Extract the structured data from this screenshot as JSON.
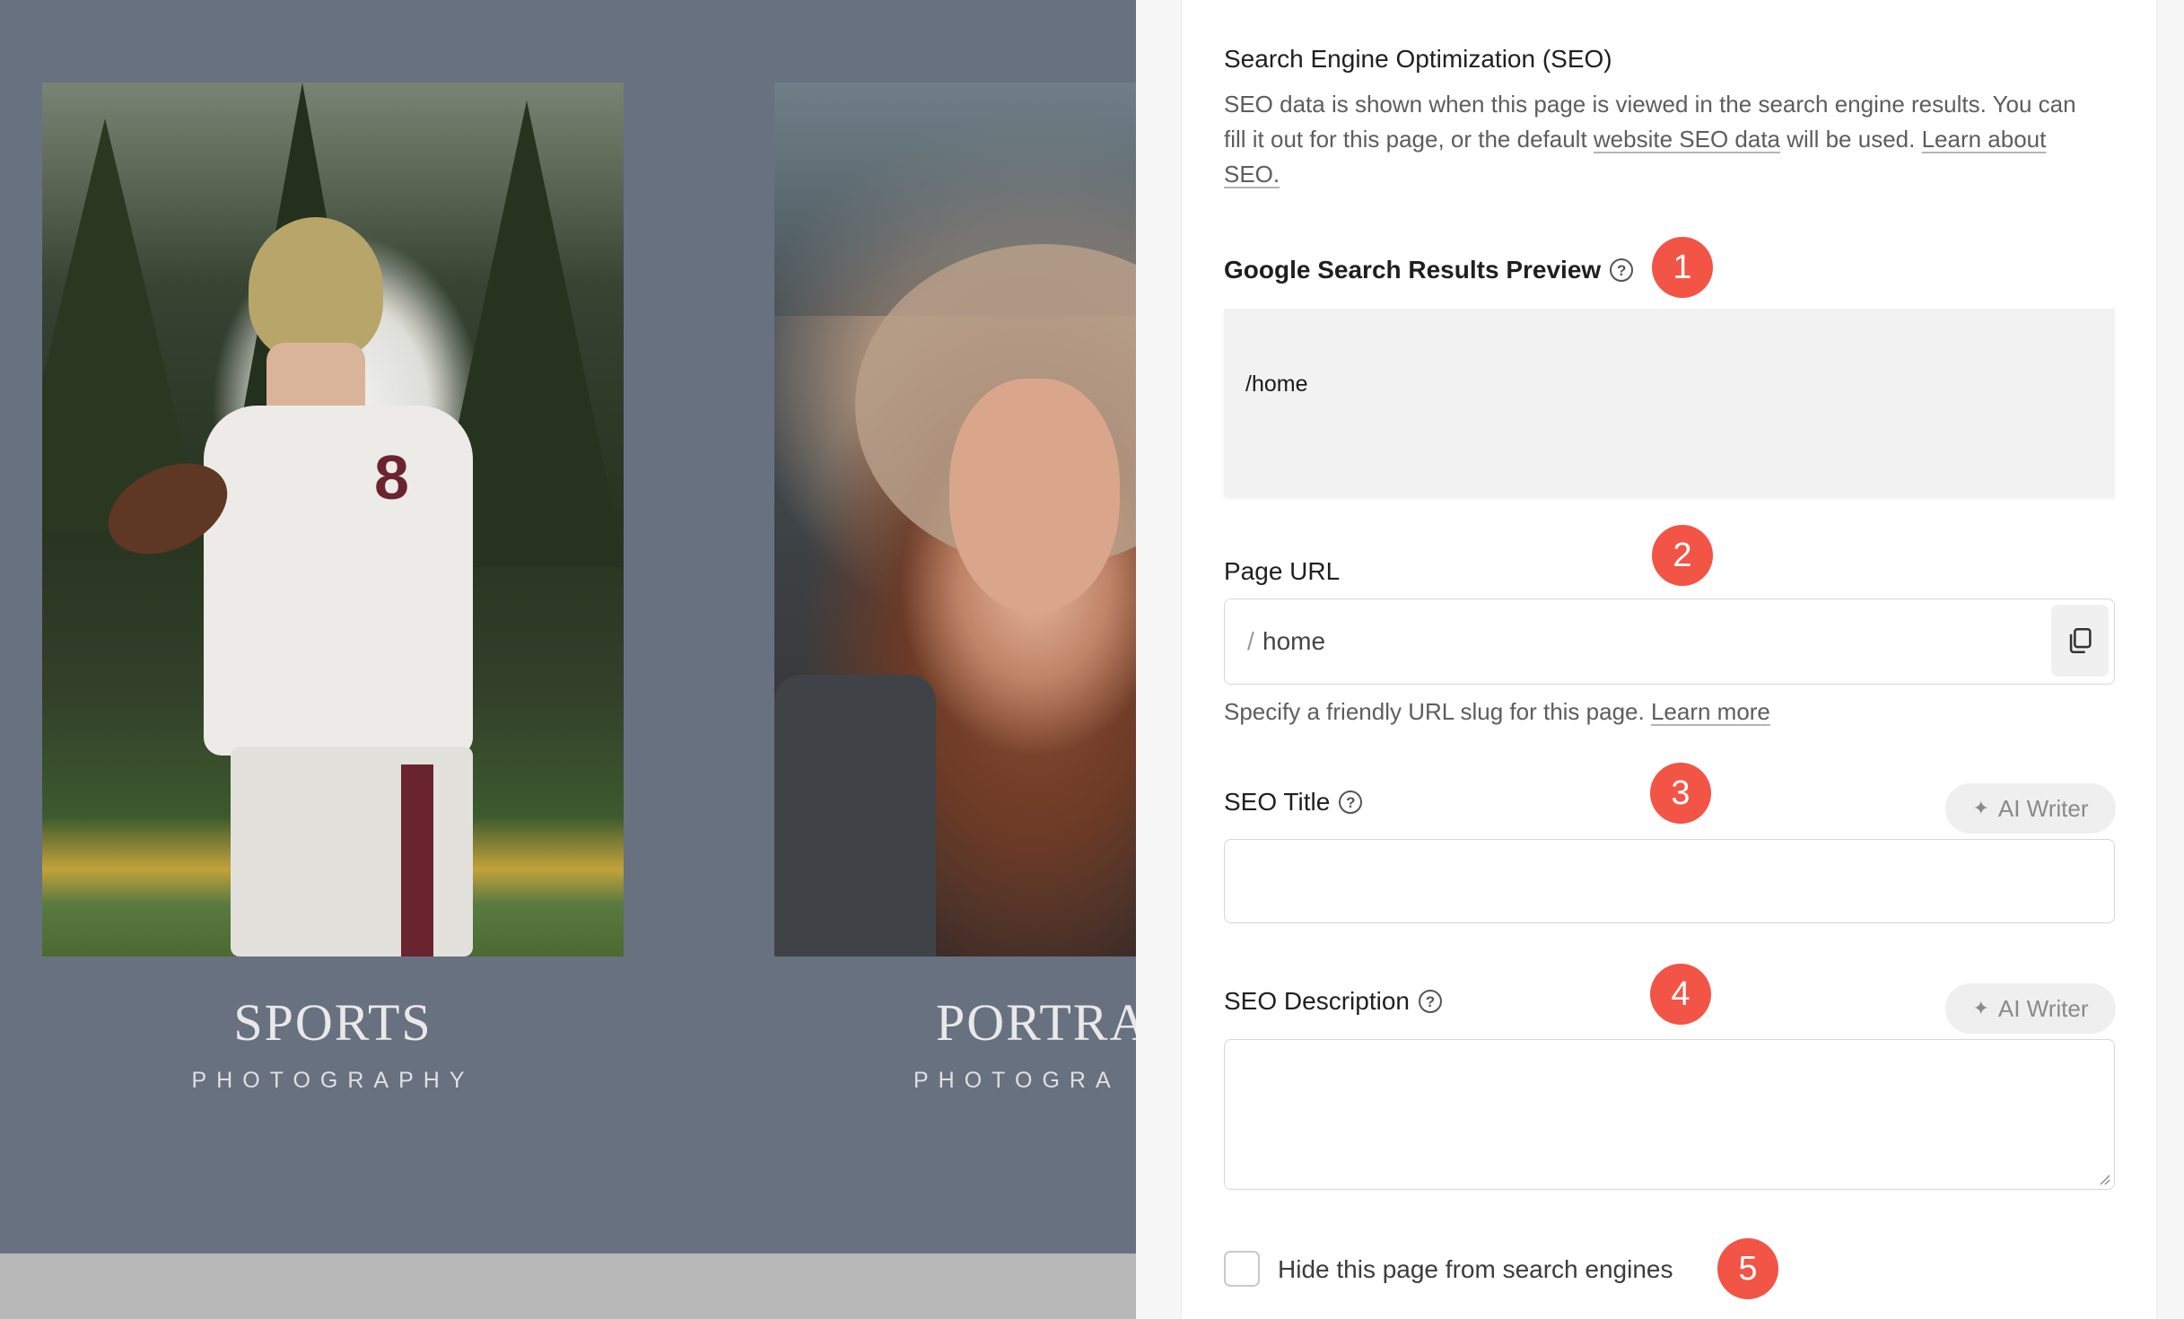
{
  "site_preview": {
    "cards": [
      {
        "title": "SPORTS",
        "subtitle": "PHOTOGRAPHY"
      },
      {
        "title": "PORTRA",
        "subtitle": "PHOTOGRA"
      }
    ]
  },
  "seo": {
    "heading": "Search Engine Optimization (SEO)",
    "description": {
      "text": "SEO data is shown when this page is viewed in the search engine results. You can fill it out for this page, or the default ",
      "link1": "website SEO data",
      "middle": " will be used. ",
      "link2": "Learn about SEO."
    },
    "preview": {
      "label": "Google Search Results Preview",
      "badge": "1",
      "url_text": "/home"
    },
    "page_url": {
      "label": "Page URL",
      "badge": "2",
      "prefix": "/",
      "value": "home",
      "hint": "Specify a friendly URL slug for this page. ",
      "hint_link": "Learn more"
    },
    "seo_title": {
      "label": "SEO Title",
      "badge": "3",
      "value": "",
      "ai_label": "AI Writer"
    },
    "seo_description": {
      "label": "SEO Description",
      "badge": "4",
      "value": "",
      "ai_label": "AI Writer"
    },
    "hide_checkbox": {
      "label": "Hide this page from search engines",
      "badge": "5",
      "checked": false
    }
  },
  "colors": {
    "badge": "#f25446",
    "preview_bg": "#687180"
  }
}
